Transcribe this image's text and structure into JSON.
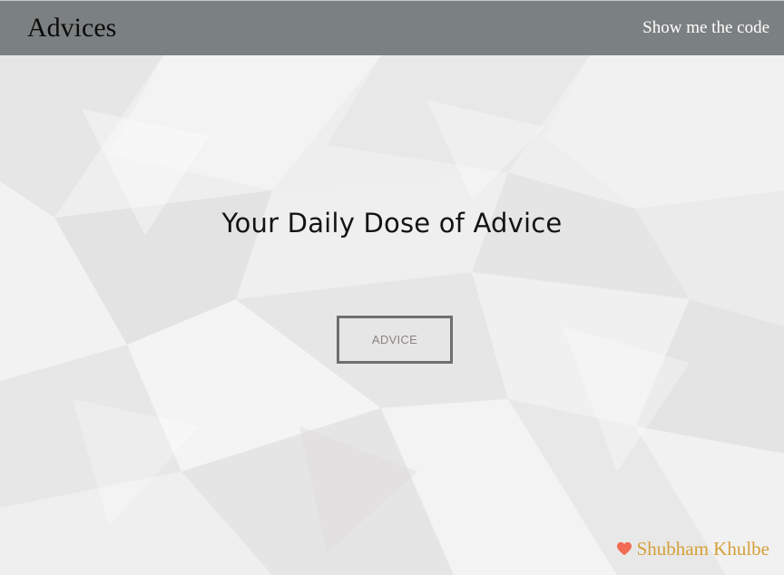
{
  "navbar": {
    "brand": "Advices",
    "code_link": "Show me the code"
  },
  "main": {
    "heading": "Your Daily Dose of Advice",
    "advice_button": "ADVICE"
  },
  "footer": {
    "heart_icon": "heart-icon",
    "author": "Shubham Khulbe"
  },
  "colors": {
    "navbar_bg": "#7b8081",
    "author_text": "#d4a13a",
    "heart": "#f26b55"
  }
}
